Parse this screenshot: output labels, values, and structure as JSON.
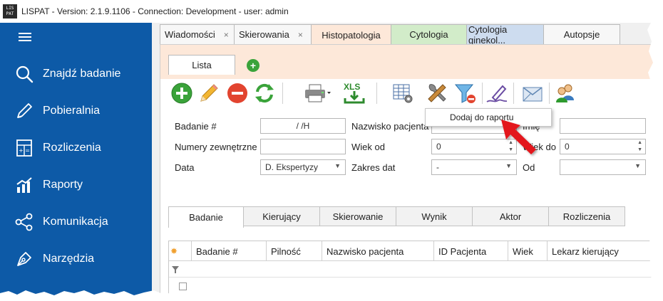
{
  "titlebar": {
    "logo_top": "LIS",
    "logo_bottom": "PAT",
    "title": "LISPAT - Version: 2.1.9.1106 - Connection: Development - user: admin"
  },
  "colors": {
    "sidebar": "#0d5aa7",
    "histopatologia_tab": "#fde8d9",
    "cytologia_tab": "#d2ecc9",
    "cytologia_ginekol_tab": "#cddcef",
    "add_green": "#3aa33a",
    "delete_red": "#e2442f",
    "arrow_red": "#e3161b"
  },
  "sidebar": {
    "menu_icon": "hamburger-icon",
    "items": [
      {
        "label": "Znajdź badanie",
        "icon": "search-icon"
      },
      {
        "label": "Pobieralnia",
        "icon": "pen-icon"
      },
      {
        "label": "Rozliczenia",
        "icon": "calculator-icon"
      },
      {
        "label": "Raporty",
        "icon": "bar-chart-icon"
      },
      {
        "label": "Komunikacja",
        "icon": "share-icon"
      },
      {
        "label": "Narzędzia",
        "icon": "pen-nib-icon"
      }
    ]
  },
  "tabs": [
    {
      "label": "Wiadomości",
      "close": "×"
    },
    {
      "label": "Skierowania",
      "close": "×"
    },
    {
      "label": "Histopatologia"
    },
    {
      "label": "Cytologia"
    },
    {
      "label": "Cytologia ginekol..."
    },
    {
      "label": "Autopsje"
    }
  ],
  "subtabs": {
    "lista": "Lista",
    "add_icon": "plus-icon",
    "add_symbol": "+"
  },
  "toolbar": {
    "xls_label": "XLS",
    "icons": [
      "add-icon",
      "edit-pencil-icon",
      "delete-icon",
      "refresh-icon",
      "printer-icon",
      "xls-export-icon",
      "grid-settings-icon",
      "tools-icon",
      "filter-remove-icon",
      "signature-pen-icon",
      "envelope-icon",
      "users-icon"
    ]
  },
  "popup": {
    "label": "Dodaj do raportu"
  },
  "form": {
    "badanie_label": "Badanie #",
    "badanie_value": " /  /H",
    "numery_label": "Numery zewnętrzne",
    "numery_value": "",
    "data_label": "Data",
    "data_value": "D. Ekspertyzy",
    "nazwisko_label": "Nazwisko pacjenta",
    "nazwisko_value": "",
    "wiek_od_label": "Wiek od",
    "wiek_od_value": "0",
    "zakres_label": "Zakres dat",
    "zakres_value": "-",
    "imie_label": "Imię",
    "imie_value": "",
    "wiek_do_label": "Wiek do",
    "wiek_do_value": "0",
    "od_label": "Od",
    "od_value": ""
  },
  "detail_tabs": [
    "Badanie",
    "Kierujący",
    "Skierowanie",
    "Wynik",
    "Aktor",
    "Rozliczenia"
  ],
  "grid": {
    "columns": [
      "Badanie #",
      "Pilność",
      "Nazwisko pacjenta",
      "ID Pacjenta",
      "Wiek",
      "Lekarz kierujący"
    ]
  }
}
